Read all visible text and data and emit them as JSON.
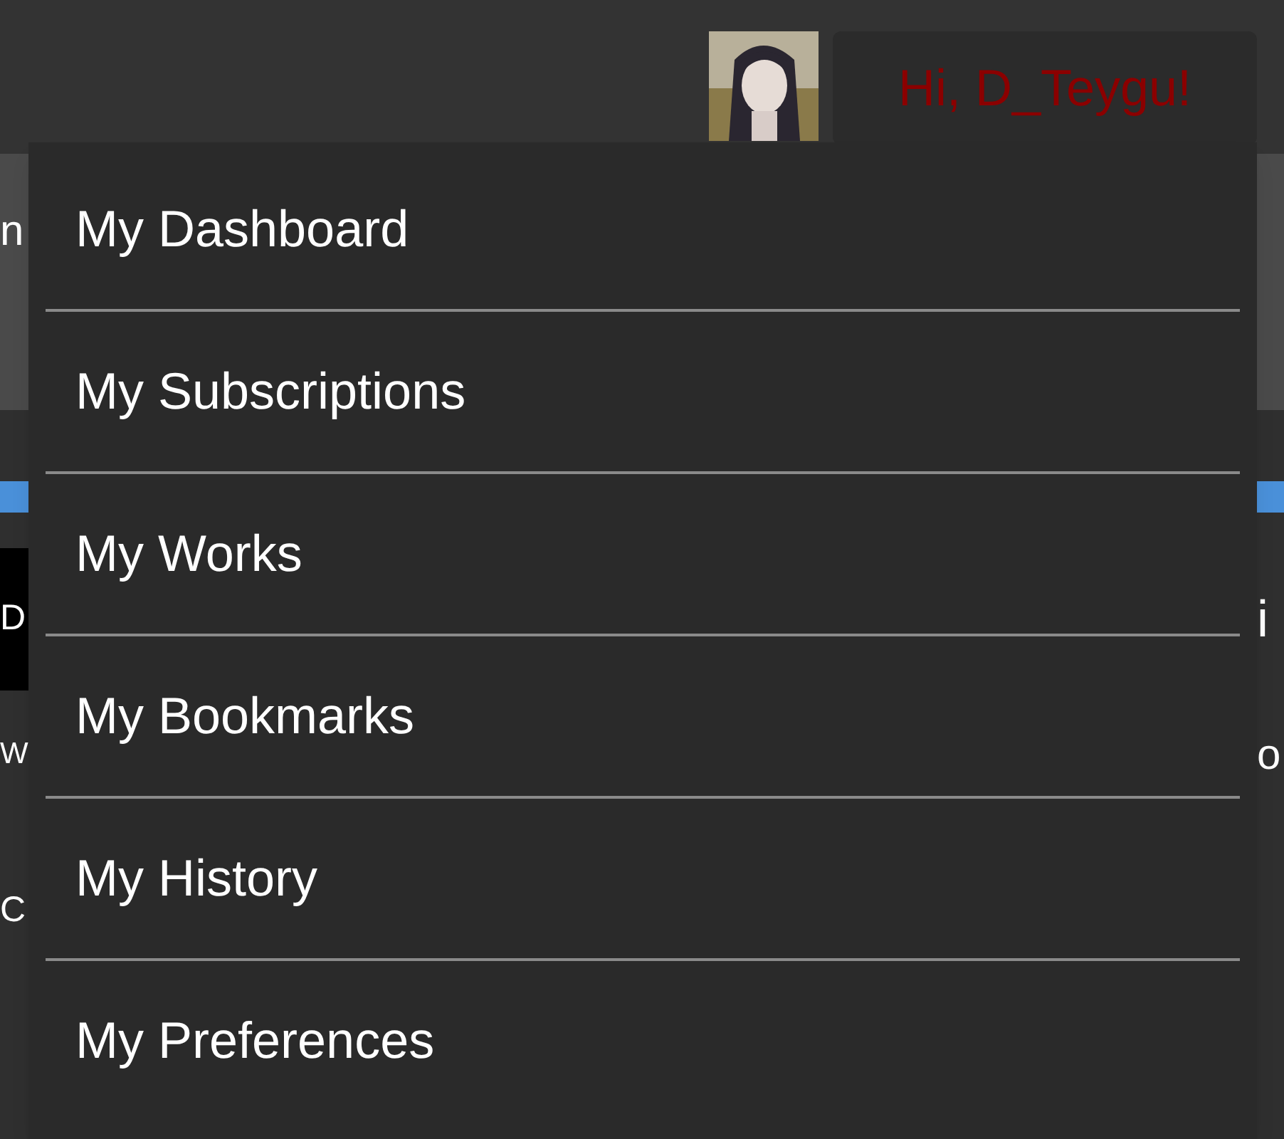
{
  "header": {
    "greeting": "Hi, D_Teygu!"
  },
  "background_fragments": {
    "left": [
      "n",
      "D",
      "W",
      "C"
    ],
    "right": [
      "i",
      "o"
    ]
  },
  "user_menu": {
    "items": [
      {
        "label": "My Dashboard"
      },
      {
        "label": "My Subscriptions"
      },
      {
        "label": "My Works"
      },
      {
        "label": "My Bookmarks"
      },
      {
        "label": "My History"
      },
      {
        "label": "My Preferences"
      }
    ]
  }
}
